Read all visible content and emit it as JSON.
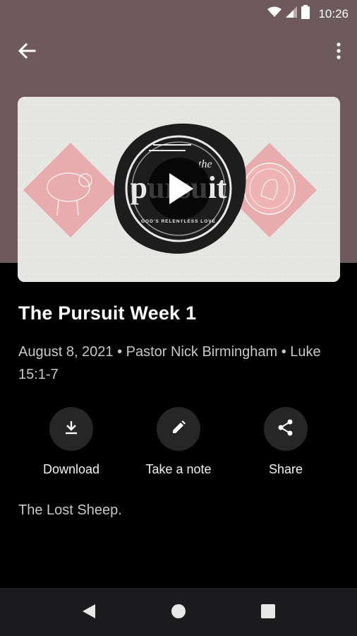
{
  "status_bar": {
    "time": "10:26",
    "icons": [
      "wifi-icon",
      "signal-icon",
      "battery-icon"
    ]
  },
  "app_bar": {
    "back_icon": "arrow-left-icon",
    "menu_icon": "more-vert-icon"
  },
  "artwork": {
    "overlay_word_top": "the",
    "overlay_word_main": "pursuit",
    "overlay_subtitle": "GOD'S RELENTLESS LOVE",
    "play_icon": "play-icon"
  },
  "sermon": {
    "title": "The Pursuit Week 1",
    "meta": "August 8, 2021 • Pastor Nick Birmingham  • Luke 15:1-7",
    "description": "The Lost Sheep."
  },
  "actions": [
    {
      "label": "Download",
      "icon": "download-icon"
    },
    {
      "label": "Take a note",
      "icon": "pencil-icon"
    },
    {
      "label": "Share",
      "icon": "share-icon"
    }
  ],
  "nav_bar": {
    "icons": [
      "nav-back-icon",
      "nav-home-icon",
      "nav-recents-icon"
    ]
  },
  "colors": {
    "header_bg": "#6e5a5c",
    "background": "#000000",
    "action_circle": "#262626",
    "nav_bar": "#1c1c1e",
    "diamond": "#e8a1a4"
  }
}
